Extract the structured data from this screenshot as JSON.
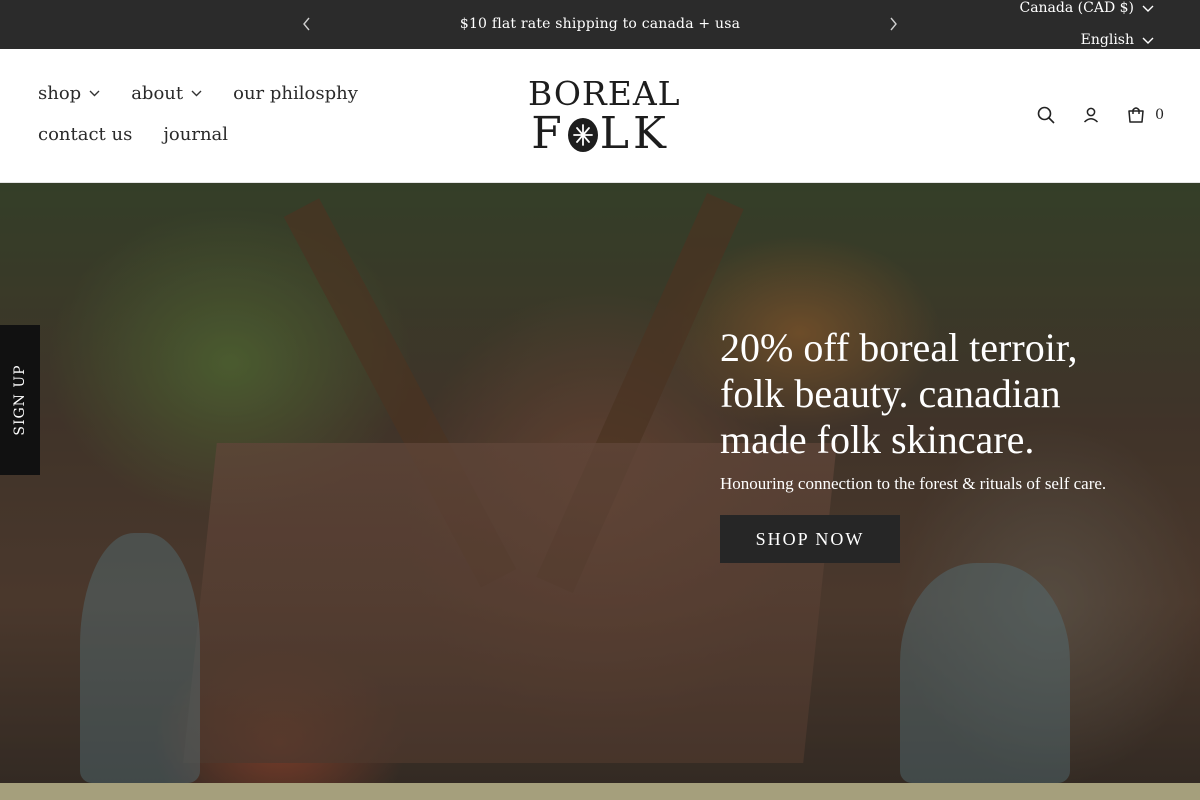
{
  "announcement": {
    "message": "$10 flat rate shipping to canada + usa",
    "prev_icon": "chevron-left-icon",
    "next_icon": "chevron-right-icon"
  },
  "locale": {
    "country": "Canada (CAD $)",
    "language": "English"
  },
  "nav": {
    "items": [
      {
        "label": "shop",
        "has_dropdown": true
      },
      {
        "label": "about",
        "has_dropdown": true
      },
      {
        "label": "our philosphy",
        "has_dropdown": false
      },
      {
        "label": "contact us",
        "has_dropdown": false
      },
      {
        "label": "journal",
        "has_dropdown": false
      }
    ]
  },
  "logo": {
    "line1": "BOREAL",
    "line2_left": "F",
    "line2_right": "LK"
  },
  "header_icons": {
    "search": "search-icon",
    "account": "user-icon",
    "cart": "cart-icon",
    "cart_count": "0"
  },
  "hero": {
    "title": "20% off boreal terroir, folk beauty. canadian made folk skincare.",
    "subtitle": "Honouring connection to the forest & rituals of self care.",
    "button_label": "SHOP NOW"
  },
  "signup_tab": {
    "label": "SIGN UP"
  },
  "colors": {
    "announcement_bg": "#2b2b2b",
    "button_bg": "#262626",
    "footer_strip": "#a59f7c"
  }
}
